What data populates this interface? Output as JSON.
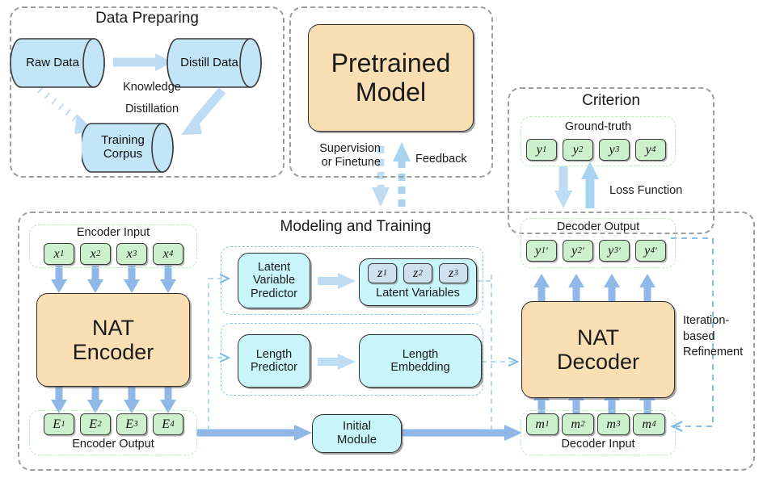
{
  "diagram": {
    "title_hidden": "",
    "groups": {
      "data_preparing": "Data Preparing",
      "modeling_training": "Modeling and Training",
      "criterion": "Criterion"
    },
    "data_preparing": {
      "raw_data": "Raw Data",
      "distill_data": "Distill Data",
      "training_corpus": "Training\nCorpus",
      "training_corpus_line1": "Training",
      "training_corpus_line2": "Corpus",
      "knowledge": "Knowledge",
      "distillation": "Distillation"
    },
    "pretrained": {
      "label_line1": "Pretrained",
      "label_line2": "Model",
      "supervision_line1": "Supervision",
      "supervision_line2": "or Finetune",
      "feedback": "Feedback"
    },
    "criterion": {
      "ground_truth_label": "Ground-truth",
      "ground_truth_tokens": [
        "y",
        "y",
        "y",
        "y"
      ],
      "ground_truth_subs": [
        "1",
        "2",
        "3",
        "4"
      ],
      "loss_function": "Loss Function"
    },
    "encoder": {
      "input_label": "Encoder Input",
      "input_tokens": [
        "x",
        "x",
        "x",
        "x"
      ],
      "input_subs": [
        "1",
        "2",
        "3",
        "4"
      ],
      "block_line1": "NAT",
      "block_line2": "Encoder",
      "output_label": "Encoder Output",
      "output_tokens": [
        "E",
        "E",
        "E",
        "E"
      ],
      "output_subs": [
        "1",
        "2",
        "3",
        "4"
      ]
    },
    "latent": {
      "predictor_line1": "Latent",
      "predictor_line2": "Variable",
      "predictor_line3": "Predictor",
      "variables_label": "Latent Variables",
      "variable_tokens": [
        "z",
        "z",
        "z"
      ],
      "variable_subs": [
        "1",
        "2",
        "3"
      ]
    },
    "length": {
      "predictor_line1": "Length",
      "predictor_line2": "Predictor",
      "embedding_line1": "Length",
      "embedding_line2": "Embedding"
    },
    "initial_module": {
      "line1": "Initial",
      "line2": "Module"
    },
    "decoder": {
      "output_label": "Decoder Output",
      "output_tokens": [
        "y",
        "y",
        "y",
        "y"
      ],
      "output_subs": [
        "1",
        "2",
        "3",
        "4"
      ],
      "output_primes": [
        "′",
        "′",
        "′",
        "′"
      ],
      "block_line1": "NAT",
      "block_line2": "Decoder",
      "input_label": "Decoder Input",
      "input_tokens": [
        "m",
        "m",
        "m",
        "m"
      ],
      "input_subs": [
        "1",
        "2",
        "3",
        "4"
      ],
      "refinement_line1": "Iteration-",
      "refinement_line2": "based",
      "refinement_line3": "Refinement"
    },
    "colors": {
      "orange_fill": "#fbdfb4",
      "cyan_fill": "#c8f6fb",
      "green_fill": "#cdf0cd",
      "blue_arrow": "#8fb8e8",
      "light_blue_arrow": "#bfdcf5",
      "cylinder_fill": "#c2e6f8",
      "group_border": "#9e9e9e",
      "dashed_blue": "#79b8e4"
    }
  }
}
